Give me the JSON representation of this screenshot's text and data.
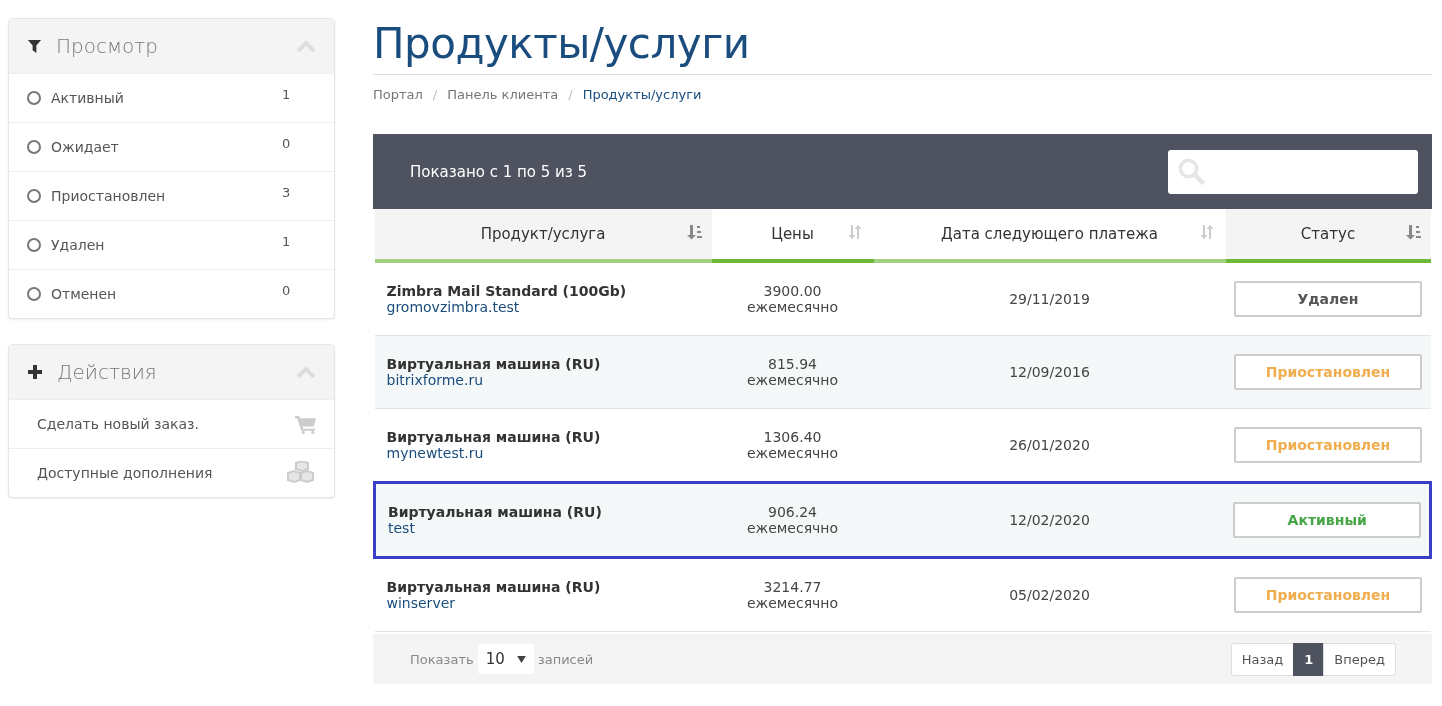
{
  "sidebar": {
    "panels": [
      {
        "kind": "filter",
        "title": "Просмотр",
        "items": [
          {
            "label": "Активный",
            "count": "1",
            "selected": false
          },
          {
            "label": "Ожидает",
            "count": "0",
            "selected": false
          },
          {
            "label": "Приостановлен",
            "count": "3",
            "selected": false
          },
          {
            "label": "Удален",
            "count": "1",
            "selected": false
          },
          {
            "label": "Отменен",
            "count": "0",
            "selected": false
          }
        ]
      },
      {
        "kind": "actions",
        "title": "Действия",
        "items": [
          {
            "label": "Сделать новый заказ."
          },
          {
            "label": "Доступные дополнения"
          }
        ]
      }
    ]
  },
  "page": {
    "title": "Продукты/услуги",
    "breadcrumb_separators": [
      "/",
      "/"
    ],
    "breadcrumb": [
      {
        "label": "Портал",
        "selected": false
      },
      {
        "label": "Панель клиента",
        "selected": false
      },
      {
        "label": "Продукты/услуги",
        "selected": true
      }
    ]
  },
  "table": {
    "info": "Показано с 1 по 5 из 5",
    "columns": [
      {
        "label": "Продукт/услуга",
        "sorted": true,
        "accent": false
      },
      {
        "label": "Цены",
        "sorted": false,
        "accent": true
      },
      {
        "label": "Дата следующего платежа",
        "sorted": false,
        "accent": false
      },
      {
        "label": "Статус",
        "sorted": true,
        "accent": true
      }
    ],
    "rows": [
      {
        "product": "Zimbra Mail Standard (100Gb)",
        "domain": "gromovzimbra.test",
        "price": "3900.00",
        "cycle": "ежемесячно",
        "date": "29/11/2019",
        "status": "Удален",
        "color": "#555555",
        "outlined": false
      },
      {
        "product": "Виртуальная машина (RU)",
        "domain": "bitrixforme.ru",
        "price": "815.94",
        "cycle": "ежемесячно",
        "date": "12/09/2016",
        "status": "Приостановлен",
        "color": "#f0ad4e",
        "outlined": false
      },
      {
        "product": "Виртуальная машина (RU)",
        "domain": "mynewtest.ru",
        "price": "1306.40",
        "cycle": "ежемесячно",
        "date": "26/01/2020",
        "status": "Приостановлен",
        "color": "#f0ad4e",
        "outlined": false
      },
      {
        "product": "Виртуальная машина (RU)",
        "domain": "test",
        "price": "906.24",
        "cycle": "ежемесячно",
        "date": "12/02/2020",
        "status": "Активный",
        "color": "#46a546",
        "outlined": true
      },
      {
        "product": "Виртуальная машина (RU)",
        "domain": "winserver",
        "price": "3214.77",
        "cycle": "ежемесячно",
        "date": "05/02/2020",
        "status": "Приостановлен",
        "color": "#f0ad4e",
        "outlined": false
      }
    ],
    "footer": {
      "show_label": "Показать",
      "page_size": "10",
      "records_label": "записей",
      "pages": [
        {
          "label": "Назад",
          "selected": false
        },
        {
          "label": "1",
          "selected": true
        },
        {
          "label": "Вперед",
          "selected": false
        }
      ]
    }
  }
}
